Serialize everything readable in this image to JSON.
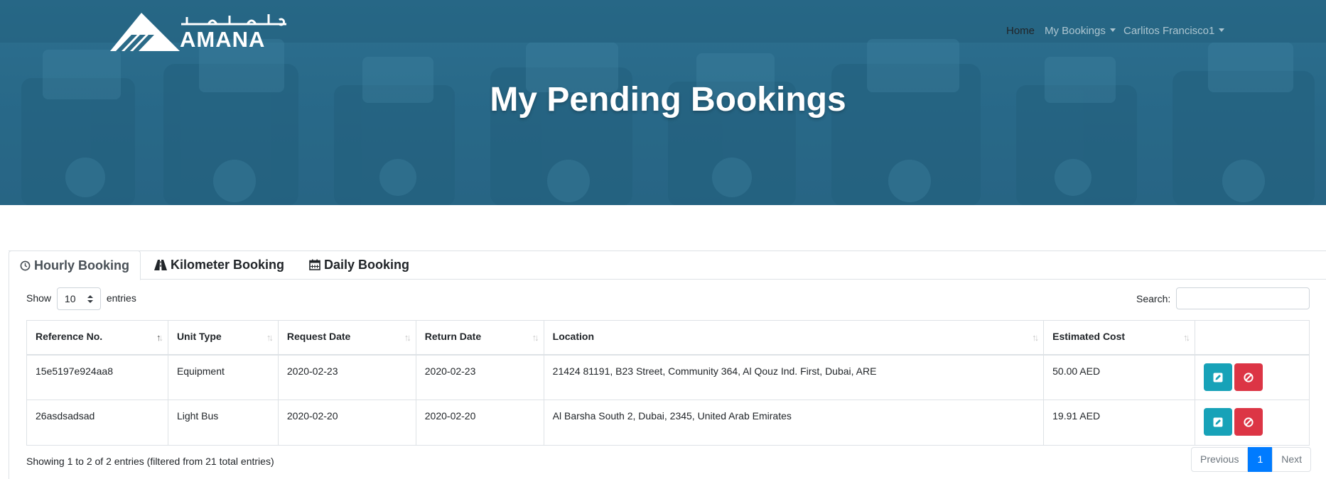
{
  "brand": {
    "name": "AMANA",
    "tagline_arabic": "امـــانـــه"
  },
  "nav": {
    "items": [
      {
        "label": "Home",
        "active": true,
        "dropdown": false
      },
      {
        "label": "My Bookings",
        "active": false,
        "dropdown": true
      },
      {
        "label": "Carlitos Francisco1",
        "active": false,
        "dropdown": true
      }
    ]
  },
  "hero": {
    "title": "My Pending Bookings"
  },
  "tabs": [
    {
      "label": "Hourly Booking",
      "icon": "clock-icon",
      "active": true
    },
    {
      "label": "Kilometer Booking",
      "icon": "road-icon",
      "active": false
    },
    {
      "label": "Daily Booking",
      "icon": "calendar-icon",
      "active": false
    }
  ],
  "table_controls": {
    "show_label": "Show",
    "entries_label": "entries",
    "page_size": "10",
    "search_label": "Search:",
    "search_value": ""
  },
  "table": {
    "columns": [
      "Reference No.",
      "Unit Type",
      "Request Date",
      "Return Date",
      "Location",
      "Estimated Cost",
      ""
    ],
    "rows": [
      {
        "reference": "15e5197e924aa8",
        "unit_type": "Equipment",
        "request_date": "2020-02-23",
        "return_date": "2020-02-23",
        "location": "21424 81191, B23 Street, Community 364, Al Qouz Ind. First, Dubai, ARE",
        "estimated_cost": "50.00 AED"
      },
      {
        "reference": "26asdsadsad",
        "unit_type": "Light Bus",
        "request_date": "2020-02-20",
        "return_date": "2020-02-20",
        "location": "Al Barsha South 2, Dubai, 2345, United Arab Emirates",
        "estimated_cost": "19.91 AED"
      }
    ]
  },
  "footer": {
    "info": "Showing 1 to 2 of 2 entries (filtered from 21 total entries)",
    "pagination": {
      "previous": "Previous",
      "current": "1",
      "next": "Next"
    }
  },
  "colors": {
    "hero_bg": "#2a6b89",
    "edit_button": "#17a2b8",
    "cancel_button": "#dc3545",
    "page_active": "#007bff"
  }
}
